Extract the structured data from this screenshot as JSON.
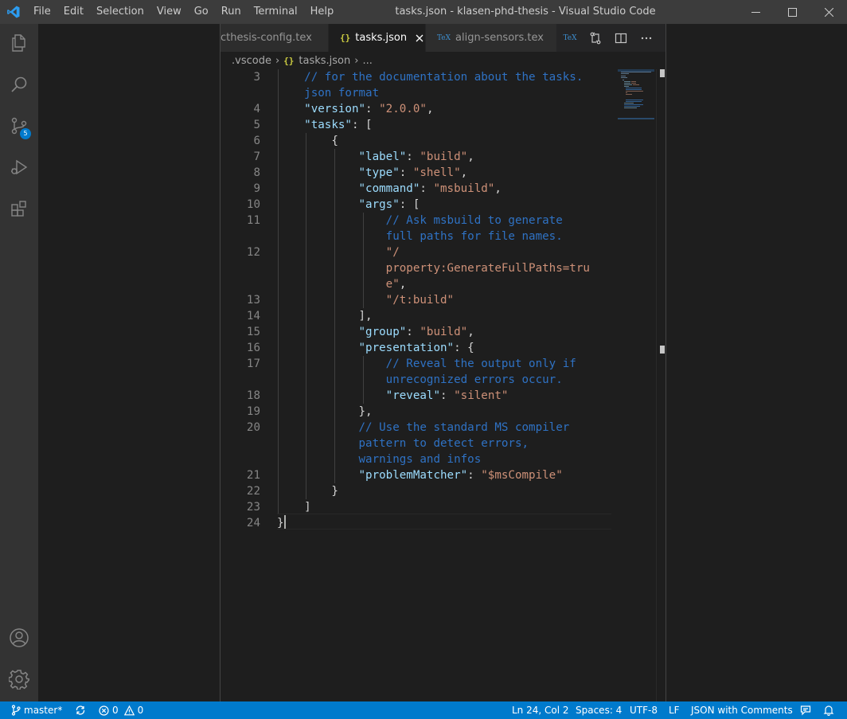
{
  "window": {
    "title": "tasks.json - klasen-phd-thesis - Visual Studio Code",
    "menu": [
      "File",
      "Edit",
      "Selection",
      "View",
      "Go",
      "Run",
      "Terminal",
      "Help"
    ]
  },
  "activity_bar": {
    "items": [
      {
        "icon": "explorer-icon"
      },
      {
        "icon": "search-icon"
      },
      {
        "icon": "source-control-icon",
        "badge": "5"
      },
      {
        "icon": "run-debug-icon"
      },
      {
        "icon": "extensions-icon"
      }
    ],
    "bottom": [
      {
        "icon": "account-icon"
      },
      {
        "icon": "manage-gear-icon"
      }
    ]
  },
  "tabs": [
    {
      "label": "cthesis-config.tex",
      "type": "tex",
      "active": false
    },
    {
      "label": "tasks.json",
      "type": "json",
      "active": true
    },
    {
      "label": "align-sensors.tex",
      "type": "tex",
      "active": false
    }
  ],
  "tab_icons": {
    "json": "{}",
    "tex": "TeX"
  },
  "breadcrumb": {
    "folder": ".vscode",
    "file": "tasks.json",
    "more": "..."
  },
  "editor": {
    "lines": [
      {
        "n": "3",
        "segs": [
          [
            "    ",
            "pun"
          ],
          [
            "// for the documentation about the tasks.",
            "cmt"
          ]
        ]
      },
      {
        "n": "",
        "segs": [
          [
            "    ",
            "pun"
          ],
          [
            "json format",
            "cmt"
          ]
        ]
      },
      {
        "n": "4",
        "segs": [
          [
            "    ",
            "pun"
          ],
          [
            "\"version\"",
            "key"
          ],
          [
            ": ",
            "pun"
          ],
          [
            "\"2.0.0\"",
            "str"
          ],
          [
            ",",
            "pun"
          ]
        ]
      },
      {
        "n": "5",
        "segs": [
          [
            "    ",
            "pun"
          ],
          [
            "\"tasks\"",
            "key"
          ],
          [
            ": [",
            "pun"
          ]
        ]
      },
      {
        "n": "6",
        "segs": [
          [
            "        {",
            "pun"
          ]
        ]
      },
      {
        "n": "7",
        "segs": [
          [
            "            ",
            "pun"
          ],
          [
            "\"label\"",
            "key"
          ],
          [
            ": ",
            "pun"
          ],
          [
            "\"build\"",
            "str"
          ],
          [
            ",",
            "pun"
          ]
        ]
      },
      {
        "n": "8",
        "segs": [
          [
            "            ",
            "pun"
          ],
          [
            "\"type\"",
            "key"
          ],
          [
            ": ",
            "pun"
          ],
          [
            "\"shell\"",
            "str"
          ],
          [
            ",",
            "pun"
          ]
        ]
      },
      {
        "n": "9",
        "segs": [
          [
            "            ",
            "pun"
          ],
          [
            "\"command\"",
            "key"
          ],
          [
            ": ",
            "pun"
          ],
          [
            "\"msbuild\"",
            "str"
          ],
          [
            ",",
            "pun"
          ]
        ]
      },
      {
        "n": "10",
        "segs": [
          [
            "            ",
            "pun"
          ],
          [
            "\"args\"",
            "key"
          ],
          [
            ": [",
            "pun"
          ]
        ]
      },
      {
        "n": "11",
        "segs": [
          [
            "                ",
            "pun"
          ],
          [
            "// Ask msbuild to generate",
            "cmt"
          ]
        ]
      },
      {
        "n": "",
        "segs": [
          [
            "                ",
            "pun"
          ],
          [
            "full paths for file names.",
            "cmt"
          ]
        ]
      },
      {
        "n": "12",
        "segs": [
          [
            "                ",
            "pun"
          ],
          [
            "\"/",
            "str"
          ]
        ]
      },
      {
        "n": "",
        "segs": [
          [
            "                ",
            "pun"
          ],
          [
            "property:GenerateFullPaths=tru",
            "str"
          ]
        ]
      },
      {
        "n": "",
        "segs": [
          [
            "                ",
            "pun"
          ],
          [
            "e\"",
            "str"
          ],
          [
            ",",
            "pun"
          ]
        ]
      },
      {
        "n": "13",
        "segs": [
          [
            "                ",
            "pun"
          ],
          [
            "\"/t:build\"",
            "str"
          ]
        ]
      },
      {
        "n": "14",
        "segs": [
          [
            "            ],",
            "pun"
          ]
        ]
      },
      {
        "n": "15",
        "segs": [
          [
            "            ",
            "pun"
          ],
          [
            "\"group\"",
            "key"
          ],
          [
            ": ",
            "pun"
          ],
          [
            "\"build\"",
            "str"
          ],
          [
            ",",
            "pun"
          ]
        ]
      },
      {
        "n": "16",
        "segs": [
          [
            "            ",
            "pun"
          ],
          [
            "\"presentation\"",
            "key"
          ],
          [
            ": {",
            "pun"
          ]
        ]
      },
      {
        "n": "17",
        "segs": [
          [
            "                ",
            "pun"
          ],
          [
            "// Reveal the output only if",
            "cmt"
          ]
        ]
      },
      {
        "n": "",
        "segs": [
          [
            "                ",
            "pun"
          ],
          [
            "unrecognized errors occur.",
            "cmt"
          ]
        ]
      },
      {
        "n": "18",
        "segs": [
          [
            "                ",
            "pun"
          ],
          [
            "\"reveal\"",
            "key"
          ],
          [
            ": ",
            "pun"
          ],
          [
            "\"silent\"",
            "str"
          ]
        ]
      },
      {
        "n": "19",
        "segs": [
          [
            "            },",
            "pun"
          ]
        ]
      },
      {
        "n": "20",
        "segs": [
          [
            "            ",
            "pun"
          ],
          [
            "// Use the standard MS compiler",
            "cmt"
          ]
        ]
      },
      {
        "n": "",
        "segs": [
          [
            "            ",
            "pun"
          ],
          [
            "pattern to detect errors,",
            "cmt"
          ]
        ]
      },
      {
        "n": "",
        "segs": [
          [
            "            ",
            "pun"
          ],
          [
            "warnings and infos",
            "cmt"
          ]
        ]
      },
      {
        "n": "21",
        "segs": [
          [
            "            ",
            "pun"
          ],
          [
            "\"problemMatcher\"",
            "key"
          ],
          [
            ": ",
            "pun"
          ],
          [
            "\"$msCompile\"",
            "str"
          ]
        ]
      },
      {
        "n": "22",
        "segs": [
          [
            "        }",
            "pun"
          ]
        ]
      },
      {
        "n": "23",
        "segs": [
          [
            "    ]",
            "pun"
          ]
        ]
      },
      {
        "n": "24",
        "segs": [
          [
            "}",
            "pun"
          ]
        ]
      }
    ]
  },
  "status_bar": {
    "branch": "master*",
    "errors": "0",
    "warnings": "0",
    "position": "Ln 24, Col 2",
    "spaces": "Spaces: 4",
    "encoding": "UTF-8",
    "eol": "LF",
    "language": "JSON with Comments"
  },
  "colors": {
    "statusbar": "#007acc",
    "titlebar": "#3c3c3c",
    "activitybar": "#333333",
    "editor": "#1e1e1e"
  }
}
